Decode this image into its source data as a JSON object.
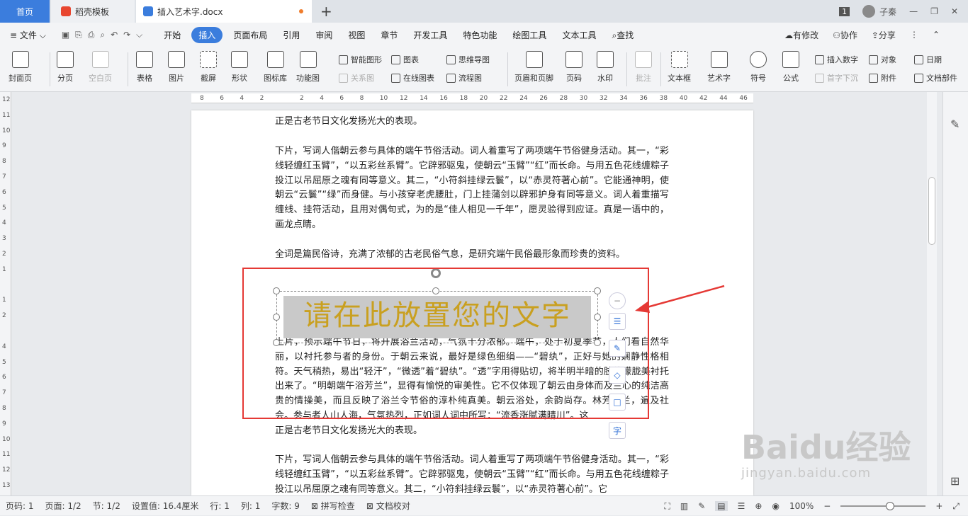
{
  "tabs": {
    "home": "首页",
    "daoke": "稻壳模板",
    "doc": "插入艺术字.docx",
    "new_tab": "+"
  },
  "window": {
    "badge": "1",
    "user": "子秦"
  },
  "menu": {
    "file": "文件",
    "items": [
      "开始",
      "插入",
      "页面布局",
      "引用",
      "审阅",
      "视图",
      "章节",
      "开发工具",
      "特色功能",
      "绘图工具",
      "文本工具"
    ],
    "active": "插入",
    "search": "查找",
    "changes": "有修改",
    "collab": "协作",
    "share": "分享"
  },
  "ribbon": {
    "cover": "封面页",
    "page_break": "分页",
    "blank": "空白页",
    "table": "表格",
    "picture": "图片",
    "screenshot": "截屏",
    "shape": "形状",
    "icons": "图标库",
    "func": "功能图",
    "smart": "智能图形",
    "chart": "图表",
    "mindmap": "思维导图",
    "relation": "关系图",
    "online_chart": "在线图表",
    "flowchart": "流程图",
    "header_footer": "页眉和页脚",
    "page_num": "页码",
    "watermark": "水印",
    "comment": "批注",
    "textbox": "文本框",
    "wordart": "艺术字",
    "symbol": "符号",
    "formula": "公式",
    "insert_num": "插入数字",
    "object": "对象",
    "date": "日期",
    "drop_cap": "首字下沉",
    "attach": "附件",
    "doc_parts": "文档部件"
  },
  "ruler": {
    "h": [
      "8",
      "6",
      "4",
      "2",
      "",
      "2",
      "4",
      "6",
      "8",
      "10",
      "12",
      "14",
      "16",
      "18",
      "20",
      "22",
      "24",
      "26",
      "28",
      "30",
      "32",
      "34",
      "36",
      "38",
      "40",
      "42",
      "44",
      "46"
    ],
    "v": [
      "12",
      "11",
      "10",
      "9",
      "8",
      "7",
      "6",
      "5",
      "4",
      "3",
      "2",
      "1",
      "",
      "1",
      "2",
      "",
      "4",
      "5",
      "6",
      "7",
      "8",
      "9",
      "10",
      "11",
      "12",
      "13"
    ]
  },
  "doc": {
    "p1_tail": "正是古老节日文化发扬光大的表现。",
    "p2": "下片，写词人偕朝云参与具体的端午节俗活动。词人着重写了两项端午节俗健身活动。其一，“彩线轻缠红玉臂”，“以五彩丝系臂”。它辟邪驱鬼，使朝云“玉臂”“红”而长命。与用五色花线缠粽子投江以吊屈原之魂有同等意义。其二，“小符斜挂绿云鬟”，以“赤灵符著心前”。它能通神明，使朝云“云鬟”“绿”而身健。与小孩穿老虎腰肚，门上挂蒲剑以辟邪护身有同等意义。词人着重描写缠线、挂符活动，且用对偶句式，为的是“佳人相见一千年”，愿灵验得到应证。真是一语中的，画龙点睛。",
    "p3": "全词是篇民俗诗，充满了浓郁的古老民俗气息，是研究端午民俗最形象而珍贵的资料。",
    "wordart": "请在此放置您的文字",
    "p4": "上片，预示端午节日，将开展浴兰活动，气氛十分浓郁。端午，处于初夏季节，人们看自然华丽，以衬托参与者的身份。于朝云来说，最好是绿色细绢——“碧纨”，正好与她的娴静性格相符。天气稍热，易出“轻汗”，“微透”着“碧纨”。“透”字用得贴切，将半明半暗的肢体朦胧美衬托出来了。“明朝端午浴芳兰”，显得有愉悦的审美性。它不仅体现了朝云由身体而及兰心的纯洁高贵的情操美，而且反映了浴兰令节俗的淳朴纯真美。朝云浴处，余韵尚存。林芳浴兰，遍及社会。参与者人山人海，气氛热烈，正如词人词中所写：“流香涨腻满晴川”。这",
    "p4_tail": "正是古老节日文化发扬光大的表现。",
    "p5": "下片，写词人偕朝云参与具体的端午节俗活动。词人着重写了两项端午节俗健身活动。其一，“彩线轻缠红玉臂”，“以五彩丝系臂”。它辟邪驱鬼，使朝云“玉臂”“红”而长命。与用五色花线缠粽子投江以吊屈原之魂有同等意义。其二，“小符斜挂绿云鬟”，以“赤灵符著心前”。它"
  },
  "float_tools": {
    "text_tool": "字"
  },
  "status": {
    "page": "页码: 1",
    "pages": "页面: 1/2",
    "section": "节: 1/2",
    "setting": "设置值: 16.4厘米",
    "row": "行: 1",
    "col": "列: 1",
    "words": "字数: 9",
    "spell": "拼写检查",
    "proof": "文档校对",
    "zoom": "100%",
    "minus": "−",
    "plus": "+"
  },
  "watermark": {
    "brand": "Baidu经验",
    "url": "jingyan.baidu.com"
  },
  "colors": {
    "accent": "#3b7ddd",
    "wordart": "#c9a020",
    "highlight_box": "#e53935"
  }
}
